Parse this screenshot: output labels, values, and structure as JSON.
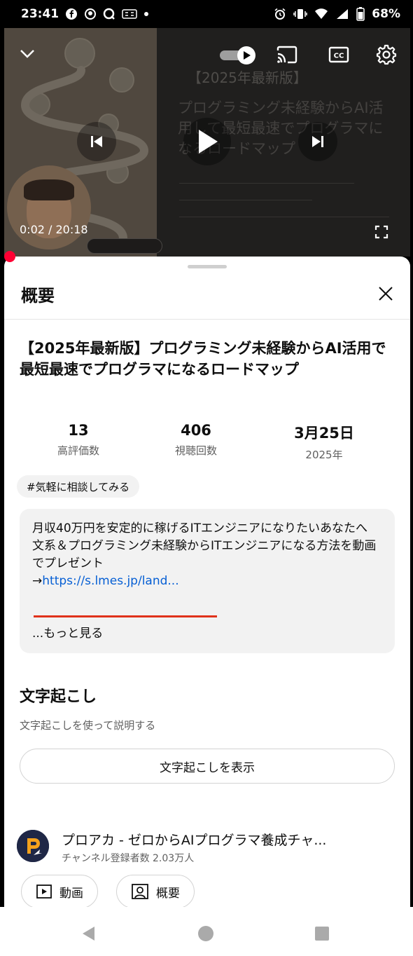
{
  "status_bar": {
    "time": "23:41",
    "battery": "68%",
    "left_icons": [
      "facebook-icon",
      "messenger-icon",
      "q-app-icon",
      "app-icon",
      "dot-icon"
    ],
    "right_icons": [
      "alarm-icon",
      "vibrate-icon",
      "wifi-icon",
      "signal-icon",
      "battery-icon"
    ]
  },
  "player": {
    "thumbnail_title": "【2025年最新版】",
    "thumbnail_subtitle": "プログラミング未経験からAI活用して最短最速でプログラマになるロードマップ",
    "current_time": "0:02",
    "duration": "20:18",
    "time_separator": " / ",
    "autoplay_on": true,
    "accent_color": "#ff0033"
  },
  "sheet": {
    "title": "概要",
    "video_title": "【2025年最新版】プログラミング未経験からAI活用で最短最速でプログラマになるロードマップ",
    "stats": [
      {
        "value": "13",
        "label": "高評価数"
      },
      {
        "value": "406",
        "label": "視聴回数"
      },
      {
        "value": "3月25日",
        "label": "2025年"
      }
    ],
    "hashtag": "#気軽に相談してみる",
    "description": {
      "line1": "月収40万円を安定的に稼げるITエンジニアになりたいあなたへ",
      "line2": "文系＆プログラミング未経験からITエンジニアになる方法を動画でプレゼント",
      "arrow": "→",
      "link": "https://s.lmes.jp/land...",
      "more": "...もっと見る"
    },
    "transcript": {
      "heading": "文字起こし",
      "subtext": "文字起こしを使って説明する",
      "button": "文字起こしを表示"
    },
    "channel": {
      "name": "プロアカ - ゼロからAIプログラマ養成チャ...",
      "subscribers": "チャンネル登録者数 2.03万人",
      "videos_button": "動画",
      "about_button": "概要"
    }
  }
}
